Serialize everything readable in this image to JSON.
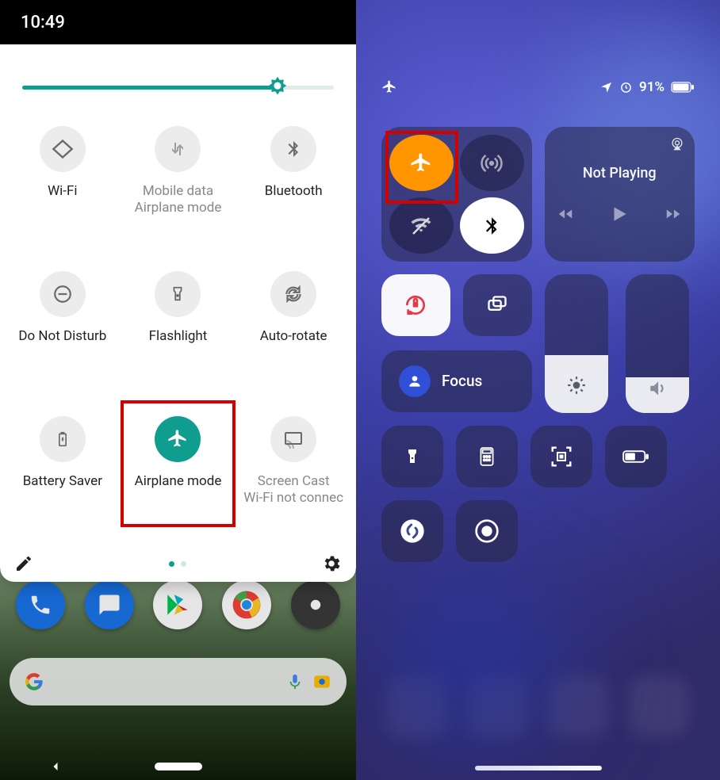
{
  "android": {
    "time": "10:49",
    "brightness_pct": 82,
    "tiles": [
      {
        "label": "Wi-Fi",
        "sub": ""
      },
      {
        "label": "Mobile data",
        "sub": "Airplane mode"
      },
      {
        "label": "Bluetooth",
        "sub": ""
      },
      {
        "label": "Do Not Disturb",
        "sub": ""
      },
      {
        "label": "Flashlight",
        "sub": ""
      },
      {
        "label": "Auto-rotate",
        "sub": ""
      },
      {
        "label": "Battery Saver",
        "sub": ""
      },
      {
        "label": "Airplane mode",
        "sub": ""
      },
      {
        "label": "Screen Cast",
        "sub": "Wi-Fi not connec"
      }
    ]
  },
  "ios": {
    "battery_pct": "91%",
    "media_title": "Not Playing",
    "focus_label": "Focus"
  }
}
